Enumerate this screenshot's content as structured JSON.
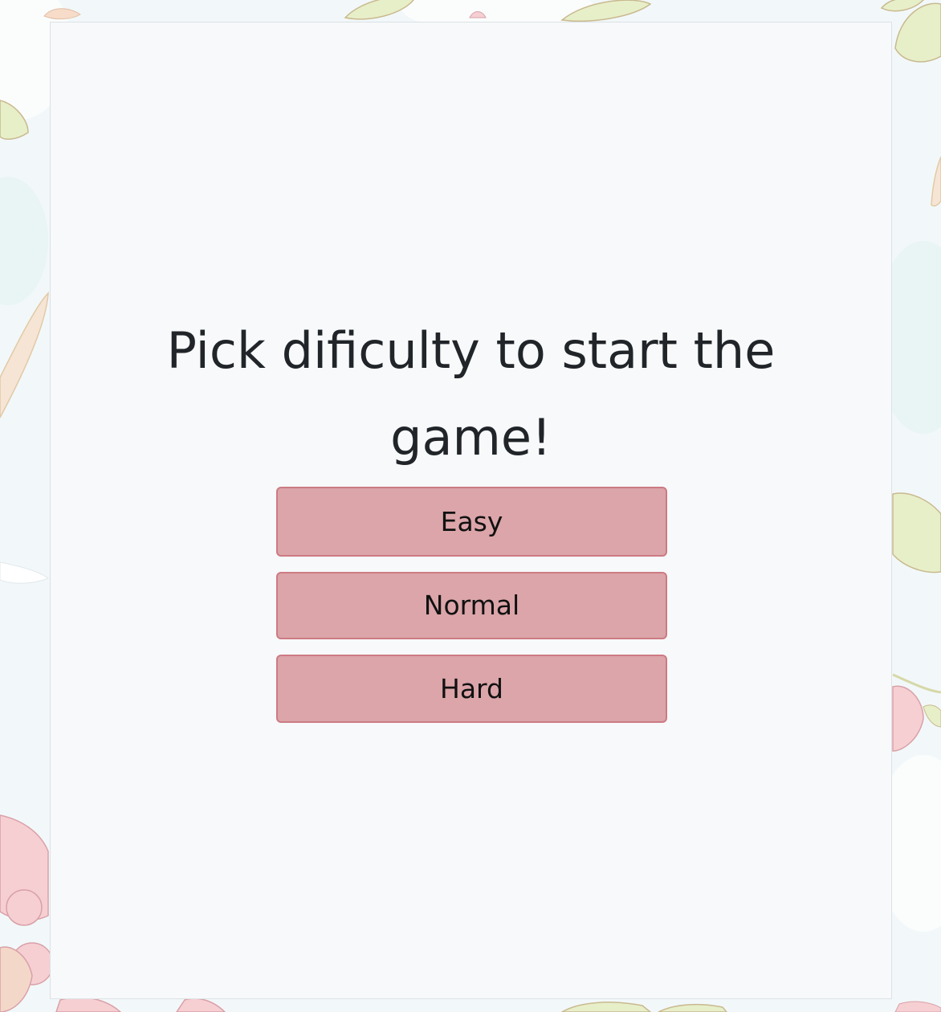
{
  "page": {
    "heading": "Pick dificulty to start the game!"
  },
  "difficulty": {
    "options": [
      {
        "label": "Easy"
      },
      {
        "label": "Normal"
      },
      {
        "label": "Hard"
      }
    ]
  },
  "colors": {
    "page_background": "#f2f8f9",
    "card_background": "#f7f9fa",
    "button_fill": "#dba5a9",
    "button_border": "#cd7a83",
    "text": "#212529",
    "leaf_fill": "#e7efc9",
    "flower_fill": "#f6cfd3"
  },
  "icons": {
    "background": "floral-leaf-pattern"
  }
}
